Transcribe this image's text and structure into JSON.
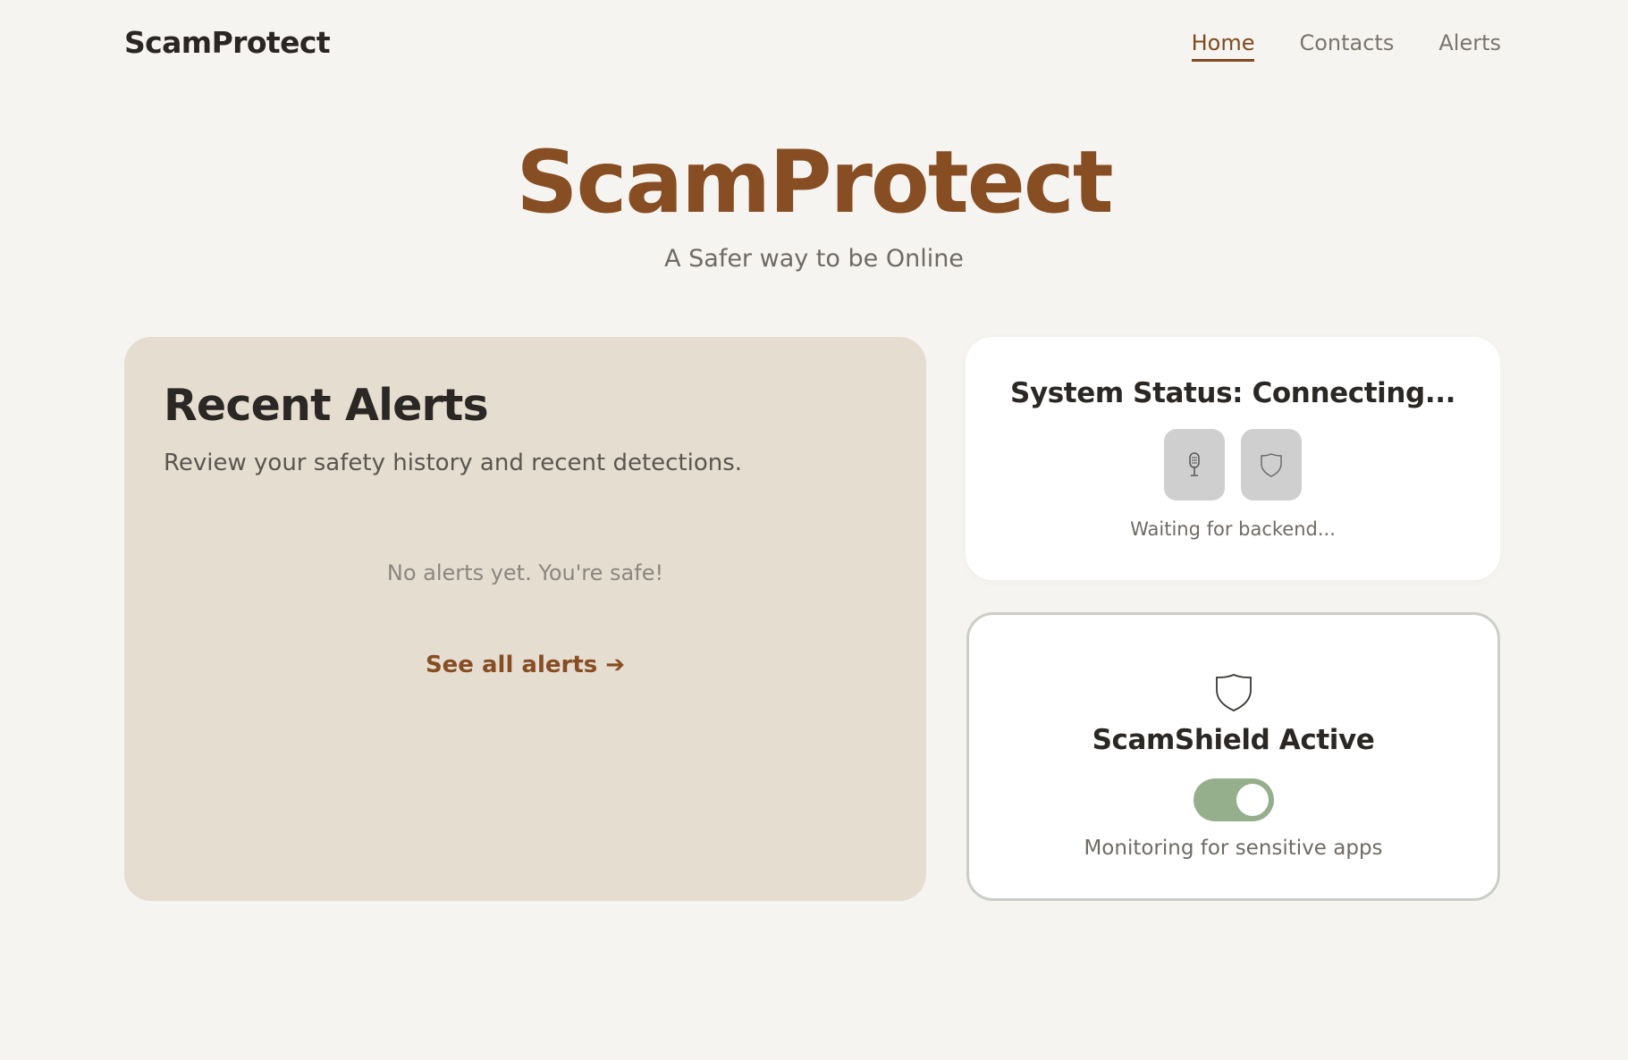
{
  "header": {
    "brand": "ScamProtect",
    "nav": [
      {
        "label": "Home",
        "active": true
      },
      {
        "label": "Contacts",
        "active": false
      },
      {
        "label": "Alerts",
        "active": false
      }
    ]
  },
  "hero": {
    "title": "ScamProtect",
    "subtitle": "A Safer way to be Online"
  },
  "alerts_card": {
    "title": "Recent Alerts",
    "description": "Review your safety history and recent detections.",
    "empty_message": "No alerts yet. You're safe!",
    "link_label": "See all alerts ➔"
  },
  "status_card": {
    "title": "System Status: Connecting...",
    "icons": [
      "microphone-icon",
      "shield-icon"
    ],
    "message": "Waiting for backend..."
  },
  "shield_card": {
    "icon": "shield-icon",
    "title": "ScamShield Active",
    "toggle_on": true,
    "message": "Monitoring for sensitive apps"
  },
  "colors": {
    "background": "#f6f4f0",
    "accent_brown": "#874d23",
    "alerts_card_bg": "#e5ddd0",
    "toggle_green": "#95ae8c",
    "status_icon_bg": "#cfcfcf"
  }
}
